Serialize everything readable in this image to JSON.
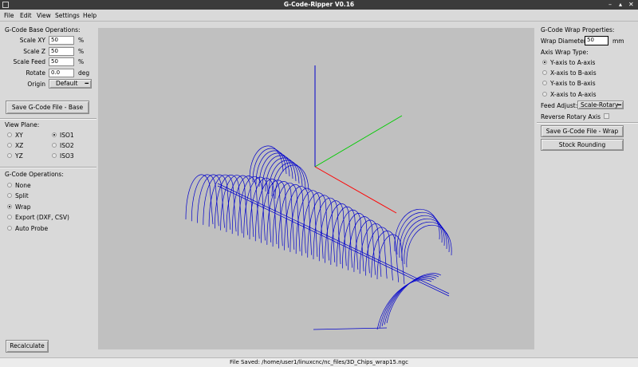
{
  "window": {
    "title": "G-Code-Ripper V0.16"
  },
  "menu": [
    "File",
    "Edit",
    "View",
    "Settings",
    "Help"
  ],
  "left": {
    "base_heading": "G-Code Base Operations:",
    "fields": [
      {
        "label": "Scale XY",
        "value": "50",
        "unit": "%"
      },
      {
        "label": "Scale Z",
        "value": "50",
        "unit": "%"
      },
      {
        "label": "Scale Feed",
        "value": "50",
        "unit": "%"
      },
      {
        "label": "Rotate",
        "value": "0.0",
        "unit": "deg"
      }
    ],
    "origin_label": "Origin",
    "origin_value": "Default",
    "save_base_label": "Save G-Code File - Base",
    "view_plane_heading": "View Plane:",
    "view_planes": [
      "XY",
      "ISO1",
      "XZ",
      "ISO2",
      "YZ",
      "ISO3"
    ],
    "view_selected": "ISO1",
    "ops_heading": "G-Code Operations:",
    "ops": [
      "None",
      "Split",
      "Wrap",
      "Export (DXF, CSV)",
      "Auto Probe"
    ],
    "ops_selected": "Wrap",
    "recalculate_label": "Recalculate"
  },
  "right": {
    "heading": "G-Code Wrap Properties:",
    "wrap_diameter_label": "Wrap Diameter",
    "wrap_diameter_value": "50",
    "wrap_diameter_unit": "mm",
    "axis_heading": "Axis Wrap Type:",
    "axis_options": [
      "Y-axis to A-axis",
      "X-axis to B-axis",
      "Y-axis to B-axis",
      "X-axis to A-axis"
    ],
    "axis_selected": "Y-axis to A-axis",
    "feed_adjust_label": "Feed Adjust:",
    "feed_adjust_value": "Scale-Rotary",
    "reverse_label": "Reverse Rotary Axis",
    "save_wrap_label": "Save G-Code File - Wrap",
    "stock_label": "Stock Rounding"
  },
  "status": "File Saved: /home/user1/linuxcnc/nc_files/3D_Chips_wrap15.ngc",
  "colors": {
    "toolpath": "#0000cc",
    "axis_x": "#ff0000",
    "axis_y": "#00cc00",
    "axis_z": "#0000cc",
    "canvas_bg": "#c0c0c0"
  }
}
